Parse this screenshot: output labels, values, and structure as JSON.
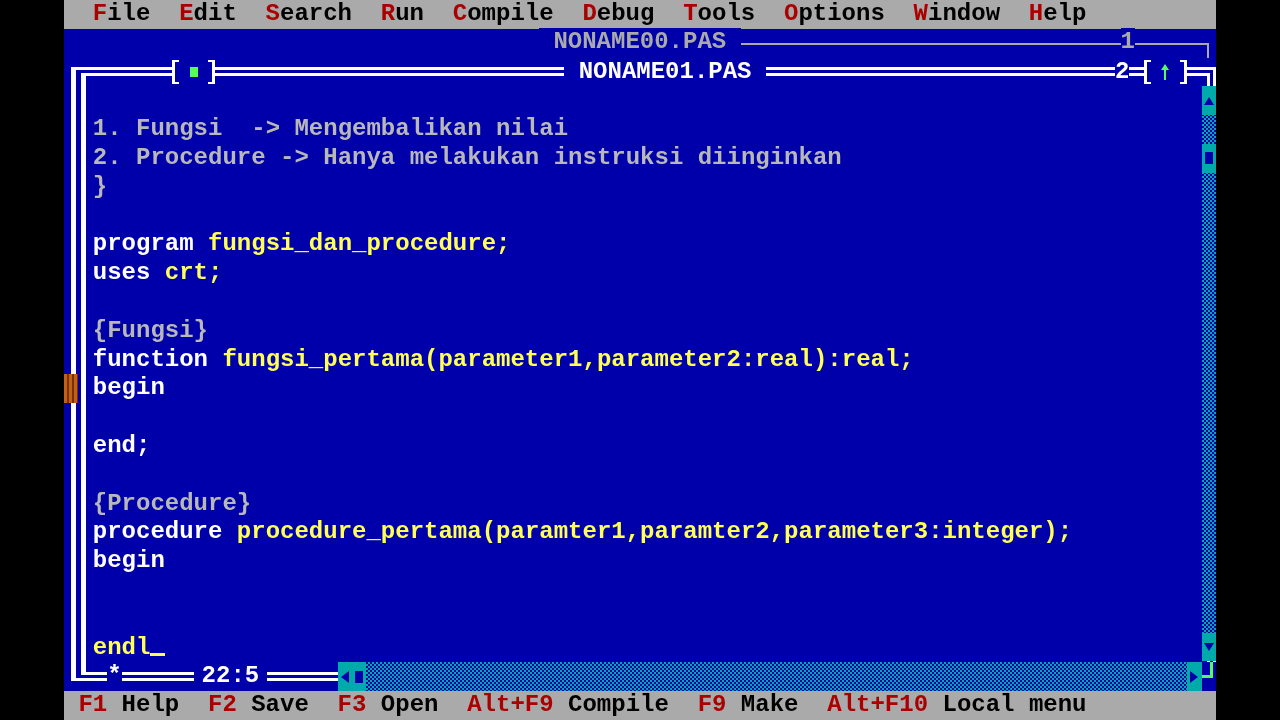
{
  "menu": [
    {
      "label": "File"
    },
    {
      "label": "Edit"
    },
    {
      "label": "Search"
    },
    {
      "label": "Run"
    },
    {
      "label": "Compile"
    },
    {
      "label": "Debug"
    },
    {
      "label": "Tools"
    },
    {
      "label": "Options"
    },
    {
      "label": "Window"
    },
    {
      "label": "Help"
    }
  ],
  "windows": [
    {
      "title": "NONAME00.PAS",
      "number": "1",
      "active": false
    },
    {
      "title": "NONAME01.PAS",
      "number": "2",
      "active": true
    }
  ],
  "editor": {
    "lines": [
      {
        "kind": "blank"
      },
      {
        "kind": "code",
        "segments": [
          {
            "kind": "comment",
            "text": "1. Fungsi  -> Mengembalikan nilai"
          }
        ]
      },
      {
        "kind": "code",
        "segments": [
          {
            "kind": "comment",
            "text": "2. Procedure -> Hanya melakukan instruksi diinginkan"
          }
        ]
      },
      {
        "kind": "code",
        "segments": [
          {
            "kind": "comment",
            "text": "}"
          }
        ]
      },
      {
        "kind": "blank"
      },
      {
        "kind": "code",
        "segments": [
          {
            "kind": "keyword",
            "text": "program "
          },
          {
            "kind": "identifier",
            "text": "fungsi_dan_procedure;"
          }
        ]
      },
      {
        "kind": "code",
        "segments": [
          {
            "kind": "keyword",
            "text": "uses "
          },
          {
            "kind": "identifier",
            "text": "crt;"
          }
        ]
      },
      {
        "kind": "blank"
      },
      {
        "kind": "code",
        "segments": [
          {
            "kind": "comment",
            "text": "{Fungsi}"
          }
        ]
      },
      {
        "kind": "code",
        "segments": [
          {
            "kind": "keyword",
            "text": "function "
          },
          {
            "kind": "identifier",
            "text": "fungsi_pertama(parameter1,parameter2:real):real;"
          }
        ]
      },
      {
        "kind": "code",
        "segments": [
          {
            "kind": "keyword",
            "text": "begin"
          }
        ]
      },
      {
        "kind": "blank"
      },
      {
        "kind": "code",
        "segments": [
          {
            "kind": "keyword",
            "text": "end;"
          }
        ]
      },
      {
        "kind": "blank"
      },
      {
        "kind": "code",
        "segments": [
          {
            "kind": "comment",
            "text": "{Procedure}"
          }
        ]
      },
      {
        "kind": "code",
        "segments": [
          {
            "kind": "keyword",
            "text": "procedure "
          },
          {
            "kind": "identifier",
            "text": "procedure_pertama(paramter1,paramter2,parameter3:integer);"
          }
        ]
      },
      {
        "kind": "code",
        "segments": [
          {
            "kind": "keyword",
            "text": "begin"
          }
        ]
      },
      {
        "kind": "blank"
      },
      {
        "kind": "blank"
      },
      {
        "kind": "code",
        "cursor": true,
        "segments": [
          {
            "kind": "identifier",
            "text": "endl"
          }
        ]
      }
    ],
    "modified_mark": "*",
    "cursor_position": "22:5"
  },
  "status_bar": [
    {
      "key": "F1",
      "label": "Help"
    },
    {
      "key": "F2",
      "label": "Save"
    },
    {
      "key": "F3",
      "label": "Open"
    },
    {
      "key": "Alt+F9",
      "label": "Compile"
    },
    {
      "key": "F9",
      "label": "Make"
    },
    {
      "key": "Alt+F10",
      "label": "Local menu"
    }
  ]
}
